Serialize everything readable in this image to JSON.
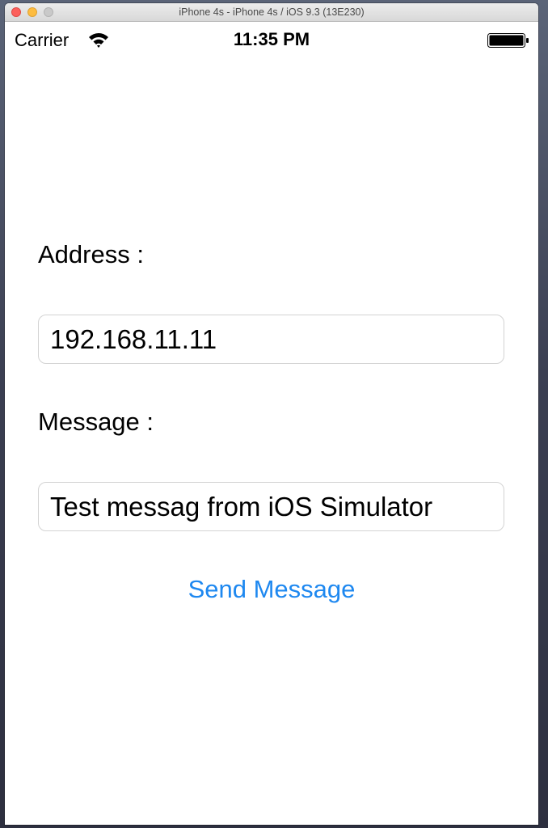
{
  "window": {
    "title": "iPhone 4s - iPhone 4s / iOS 9.3 (13E230)"
  },
  "status_bar": {
    "carrier": "Carrier",
    "time": "11:35 PM",
    "icons": [
      "wifi-icon",
      "battery-icon"
    ]
  },
  "form": {
    "address_label": "Address :",
    "address_value": "192.168.11.11",
    "message_label": "Message :",
    "message_value": "Test messag from iOS Simulator",
    "send_label": "Send Message"
  },
  "colors": {
    "accent": "#1e88f0",
    "close_button": "#fc605c",
    "minimize_button": "#fdbc40",
    "zoom_button": "#c9c9c9"
  }
}
